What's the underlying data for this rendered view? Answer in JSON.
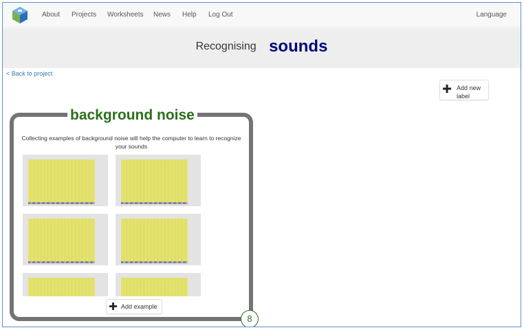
{
  "nav": {
    "items": [
      "About",
      "Projects",
      "Worksheets",
      "News",
      "Help",
      "Log Out"
    ],
    "language": "Language"
  },
  "title": {
    "prefix": "Recognising",
    "main": "sounds"
  },
  "back_link": "< Back to project",
  "add_label": {
    "line1": "Add new",
    "line2": "label"
  },
  "card": {
    "label": "background noise",
    "description": "Collecting examples of background noise will help the computer to learn to recognize your sounds",
    "add_example": "Add example",
    "count": "8",
    "examples_visible": 6
  },
  "colors": {
    "title_main": "#00087a",
    "label_green": "#2b6e1c",
    "card_border": "#747474",
    "spectrogram": "#e3e26c"
  }
}
